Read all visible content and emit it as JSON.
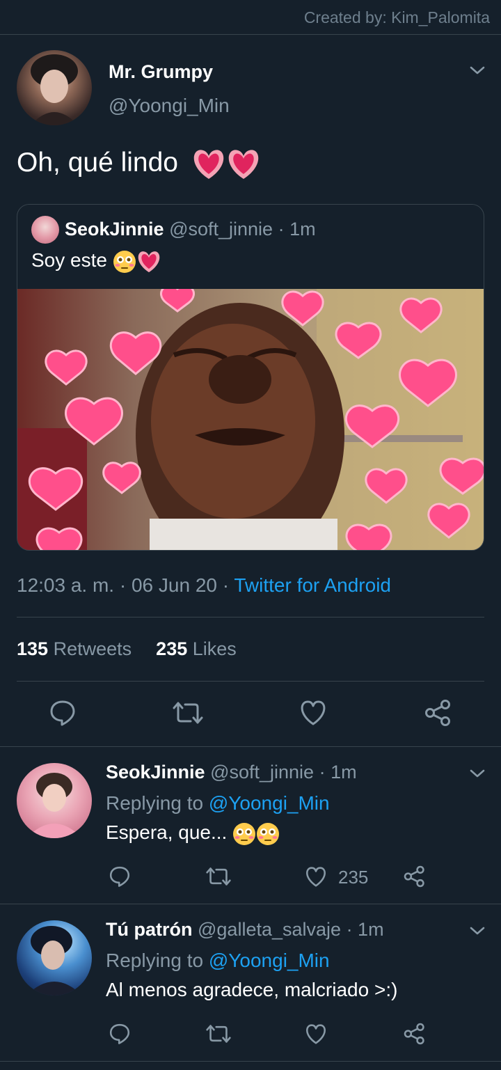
{
  "credit": "Created by: Kim_Palomita",
  "main_tweet": {
    "display_name": "Mr. Grumpy",
    "handle": "@Yoongi_Min",
    "text": "Oh, qué lindo",
    "quoted": {
      "display_name": "SeokJinnie",
      "handle": "@soft_jinnie",
      "time": "· 1m",
      "text": "Soy este"
    },
    "timestamp": "12:03 a. m. · 06 Jun 20 ·",
    "source": "Twitter for Android",
    "retweets_count": "135",
    "retweets_label": "Retweets",
    "likes_count": "235",
    "likes_label": "Likes"
  },
  "replies": [
    {
      "display_name": "SeokJinnie",
      "handle": "@soft_jinnie",
      "time": "· 1m",
      "replying_prefix": "Replying to",
      "replying_to": "@Yoongi_Min",
      "text": "Espera, que...",
      "likes": "235"
    },
    {
      "display_name": "Tú patrón",
      "handle": "@galleta_salvaje",
      "time": "· 1m",
      "replying_prefix": "Replying to",
      "replying_to": "@Yoongi_Min",
      "text": "Al menos agradece, malcriado >:)"
    }
  ],
  "colors": {
    "background": "#15202b",
    "divider": "#38444d",
    "muted": "#8899a6",
    "link": "#1da1f2",
    "heart_pink": "#ff4f8b"
  }
}
